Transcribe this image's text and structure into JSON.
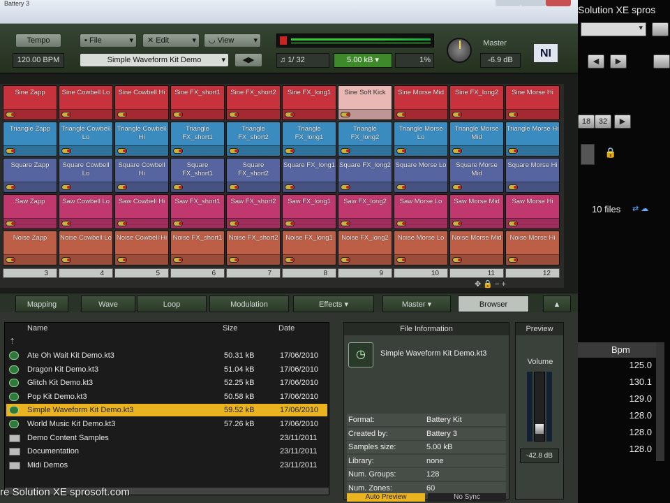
{
  "window": {
    "title": "Battery 3"
  },
  "toolbar": {
    "tempo_label": "Tempo",
    "tempo_value": "120.00 BPM",
    "file_label": "File",
    "edit_label": "Edit",
    "view_label": "View",
    "kit_name": "Simple Waveform Kit Demo",
    "voices": "1/ 32",
    "memory": "5.00 kB",
    "cpu": "1%",
    "master_label": "Master",
    "master_value": "-6.9 dB",
    "ni_logo": "NI"
  },
  "pads": [
    [
      "Sine  Zapp",
      "Sine Cowbell Lo",
      "Sine Cowbell Hi",
      "Sine FX_short1",
      "Sine FX_short2",
      "Sine FX_long1",
      "Sine Soft Kick",
      "Sine Morse Mid",
      "Sine FX_long2",
      "Sine Morse Hi"
    ],
    [
      "Triangle Zapp",
      "Triangle Cowbell Lo",
      "Triangle Cowbell Hi",
      "Triangle FX_short1",
      "Triangle FX_short2",
      "Triangle FX_long1",
      "Triangle FX_long2",
      "Triangle Morse Lo",
      "Triangle Morse Mid",
      "Triangle Morse Hi"
    ],
    [
      "Square Zapp",
      "Square Cowbell Lo",
      "Square Cowbell Hi",
      "Square FX_short1",
      "Square FX_short2",
      "Square FX_long1",
      "Square FX_long2",
      "Square Morse Lo",
      "Square Morse Mid",
      "Square Morse Hi"
    ],
    [
      "Saw Zapp",
      "Saw Cowbell Lo",
      "Saw Cowbell Hi",
      "Saw FX_short1",
      "Saw FX_short2",
      "Saw FX_long1",
      "Saw FX_long2",
      "Saw Morse Lo",
      "Saw Morse Mid",
      "Saw Morse Hi"
    ],
    [
      "Noise Zapp",
      "Noise Cowbell Lo",
      "Noise Cowbell Hi",
      "Noise FX_short1",
      "Noise FX_short2",
      "Noise FX_long1",
      "Noise FX_long2",
      "Noise Morse Lo",
      "Noise Morse Mid",
      "Noise Morse Hi"
    ]
  ],
  "column_numbers": [
    "3",
    "4",
    "5",
    "6",
    "7",
    "8",
    "9",
    "10",
    "11",
    "12"
  ],
  "tabs": [
    "Mapping",
    "Wave",
    "Loop",
    "Modulation",
    "Effects",
    "Master",
    "Browser"
  ],
  "filelist": {
    "headers": {
      "name": "Name",
      "size": "Size",
      "date": "Date"
    },
    "rows": [
      {
        "name": "Ate Oh Wait Kit Demo.kt3",
        "size": "50.31 kB",
        "date": "17/06/2010"
      },
      {
        "name": "Dragon Kit Demo.kt3",
        "size": "51.04 kB",
        "date": "17/06/2010"
      },
      {
        "name": "Glitch Kit Demo.kt3",
        "size": "52.25 kB",
        "date": "17/06/2010"
      },
      {
        "name": "Pop Kit Demo.kt3",
        "size": "50.58 kB",
        "date": "17/06/2010"
      },
      {
        "name": "Simple Waveform Kit Demo.kt3",
        "size": "59.52 kB",
        "date": "17/06/2010"
      },
      {
        "name": "World Music Kit Demo.kt3",
        "size": "57.26 kB",
        "date": "17/06/2010"
      },
      {
        "name": "Demo Content Samples",
        "size": "",
        "date": "23/11/2011"
      },
      {
        "name": "Documentation",
        "size": "",
        "date": "23/11/2011"
      },
      {
        "name": "Midi Demos",
        "size": "",
        "date": "23/11/2011"
      }
    ]
  },
  "fileinfo": {
    "header": "File Information",
    "file_name": "Simple Waveform Kit Demo.kt3",
    "rows": [
      {
        "k": "Format:",
        "v": "Battery Kit"
      },
      {
        "k": "Created by:",
        "v": "Battery 3"
      },
      {
        "k": "Samples size:",
        "v": "5.00 kB"
      },
      {
        "k": "Library:",
        "v": "none"
      },
      {
        "k": "Num. Groups:",
        "v": "128"
      },
      {
        "k": "Num. Zones:",
        "v": "60"
      }
    ],
    "auto_preview": "Auto Preview",
    "no_sync": "No Sync"
  },
  "preview": {
    "header": "Preview",
    "volume_label": "Volume",
    "volume_value": "-42.8 dB"
  },
  "right_panel": {
    "title": "Solution XE spros",
    "btn_18": "18",
    "btn_32": "32",
    "files_count": "10 files",
    "bpm_header": "Bpm",
    "bpm_values": [
      "125.0",
      "130.1",
      "129.0",
      "128.0",
      "128.0",
      "128.0"
    ]
  },
  "watermark": "re Solution XE sprosoft.com"
}
